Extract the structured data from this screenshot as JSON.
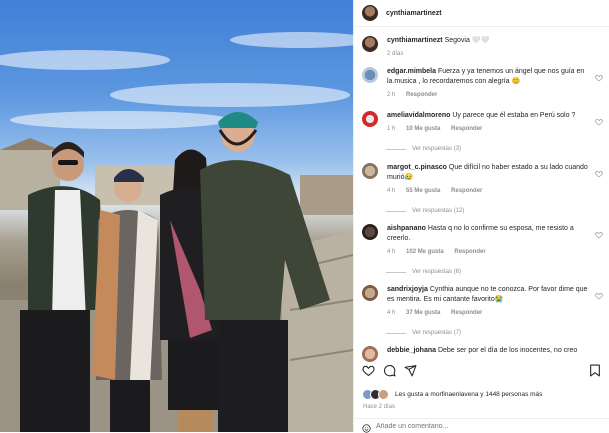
{
  "post": {
    "author": "cynthiamartinezt",
    "caption_user": "cynthiamartinezt",
    "caption_text": "Segovia 🤍🤍",
    "caption_time": "2 días"
  },
  "comments": [
    {
      "user": "edgar.mimbela",
      "text": "Fuerza y ya tenemos un ángel que nos guía en la.musica , lo recordaremos con alegría 😊",
      "time": "2 h",
      "likes": "",
      "reply": "Responder",
      "view_replies": ""
    },
    {
      "user": "ameliavidalmoreno",
      "text": "Uy parece que él estaba en Perú solo ?",
      "time": "1 h",
      "likes": "10 Me gusta",
      "reply": "Responder",
      "view_replies": "Ver respuestas (3)"
    },
    {
      "user": "margot_c.pinasco",
      "text": "Que difícil no haber estado a su lado cuando murió😥",
      "time": "4 h",
      "likes": "55 Me gusta",
      "reply": "Responder",
      "view_replies": "Ver respuestas (12)"
    },
    {
      "user": "aishpanano",
      "text": "Hasta q no lo confirme su esposa, me resisto a creerlo.",
      "time": "4 h",
      "likes": "102 Me gusta",
      "reply": "Responder",
      "view_replies": "Ver respuestas (6)"
    },
    {
      "user": "sandrixjoyja",
      "text": "Cynthia aunque no te conozca. Por favor dime que es mentira. Es mi cantante favorito😭",
      "time": "4 h",
      "likes": "37 Me gusta",
      "reply": "Responder",
      "view_replies": "Ver respuestas (7)"
    },
    {
      "user": "debbie_johana",
      "text": "Debe ser por el día de los inocentes, no creo",
      "time": "",
      "likes": "",
      "reply": "",
      "view_replies": ""
    }
  ],
  "likes_text": "Les gusta a morfinaenlavena y 1448 personas más",
  "likes_user": "morfinaenlavena",
  "likes_count": "1448 personas más",
  "posted_ago": "Hace 2 días",
  "add_comment_placeholder": "Añade un comentario...",
  "colors": {
    "text": "#262626",
    "muted": "#8e8e8e",
    "border": "#efefef",
    "sky": "#3f7fd6"
  }
}
